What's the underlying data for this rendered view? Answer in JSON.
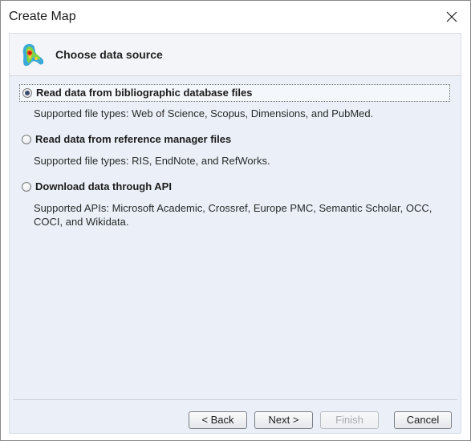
{
  "window": {
    "title": "Create Map",
    "close_icon": "close-icon"
  },
  "header": {
    "icon": "density-map-icon",
    "title": "Choose data source"
  },
  "options": [
    {
      "label": "Read data from bibliographic database files",
      "description": "Supported file types: Web of Science, Scopus, Dimensions, and PubMed.",
      "selected": true
    },
    {
      "label": "Read data from reference manager files",
      "description": "Supported file types: RIS, EndNote, and RefWorks.",
      "selected": false
    },
    {
      "label": "Download data through API",
      "description": "Supported APIs: Microsoft Academic, Crossref, Europe PMC, Semantic Scholar, OCC, COCI, and Wikidata.",
      "selected": false
    }
  ],
  "buttons": {
    "back": "< Back",
    "next": "Next >",
    "finish": "Finish",
    "cancel": "Cancel"
  },
  "colors": {
    "panel_background": "#ebf0f8",
    "disabled_text": "#a8acb2"
  }
}
